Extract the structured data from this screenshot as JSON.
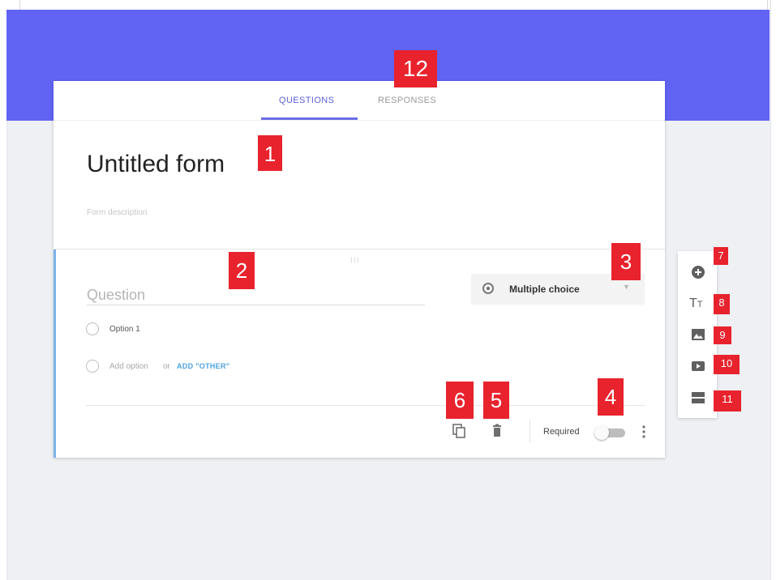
{
  "tabs": {
    "questions": "QUESTIONS",
    "responses": "RESPONSES"
  },
  "form": {
    "title": "Untitled form",
    "description_placeholder": "Form description"
  },
  "question": {
    "placeholder": "Question",
    "type": "Multiple choice",
    "options": [
      "Option 1"
    ],
    "add_option": "Add option",
    "or": "or",
    "add_other": "ADD \"OTHER\"",
    "required_label": "Required",
    "required_on": false
  },
  "toolbar": {
    "tools": [
      "add-question",
      "add-title",
      "add-image",
      "add-video",
      "add-section"
    ],
    "title_glyph": "T",
    "title_glyph_small": "T"
  },
  "callouts": {
    "c1": "1",
    "c2": "2",
    "c3": "3",
    "c4": "4",
    "c5": "5",
    "c6": "6",
    "c7": "7",
    "c8": "8",
    "c9": "9",
    "c10": "10",
    "c11": "11",
    "c12": "12"
  },
  "colors": {
    "header": "#6163f3",
    "accent": "#5b5fd6",
    "callout": "#e8232d",
    "link": "#4aa3df"
  }
}
